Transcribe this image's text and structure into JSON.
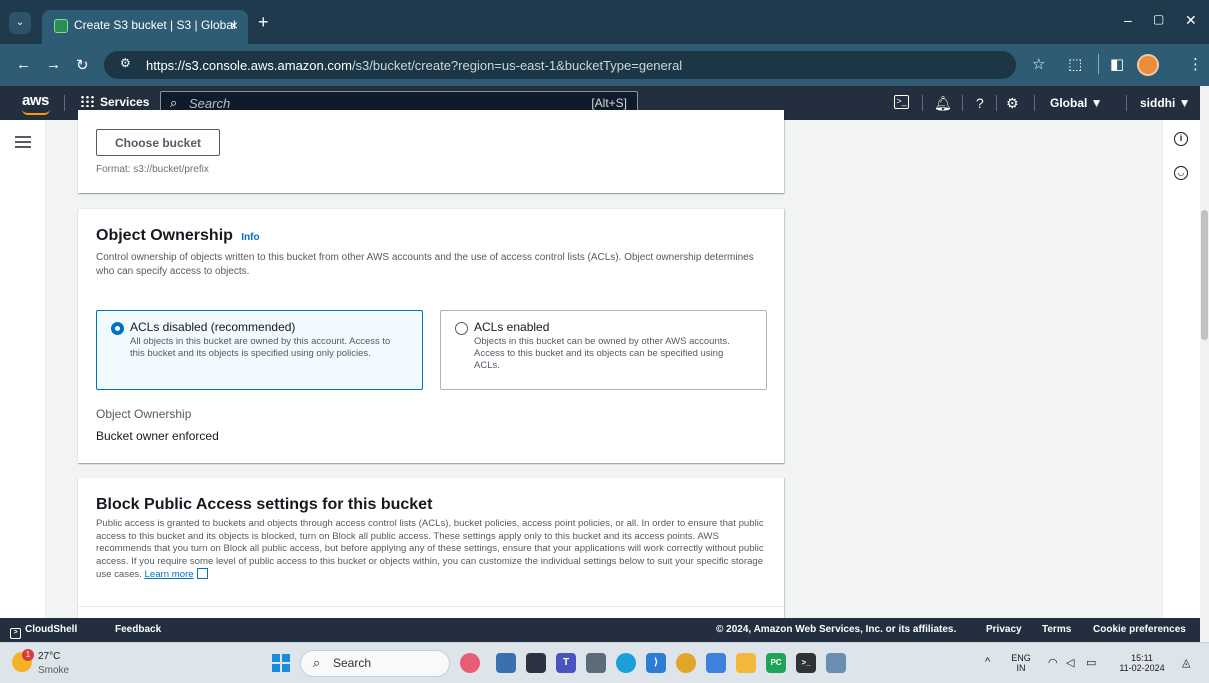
{
  "browser": {
    "tab_title": "Create S3 bucket | S3 | Global",
    "tab_close": "×",
    "new_tab": "+",
    "url_host": "https://s3.console.aws.amazon.com",
    "url_path": "/s3/bucket/create?region=us-east-1&bucketType=general",
    "win_minimize": "–",
    "win_restore": "▢",
    "win_close": "✕"
  },
  "aws_nav": {
    "logo": "aws",
    "services": "Services",
    "search_placeholder": "Search",
    "search_shortcut": "[Alt+S]",
    "region": "Global ▼",
    "user": "siddhi ▼"
  },
  "choose_bucket_panel": {
    "button": "Choose bucket",
    "format_hint": "Format: s3://bucket/prefix"
  },
  "object_ownership": {
    "title": "Object Ownership",
    "info": "Info",
    "description": "Control ownership of objects written to this bucket from other AWS accounts and the use of access control lists (ACLs). Object ownership determines who can specify access to objects.",
    "options": [
      {
        "label": "ACLs disabled (recommended)",
        "description": "All objects in this bucket are owned by this account. Access to this bucket and its objects is specified using only policies.",
        "selected": true
      },
      {
        "label": "ACLs enabled",
        "description": "Objects in this bucket can be owned by other AWS accounts. Access to this bucket and its objects can be specified using ACLs.",
        "selected": false
      }
    ],
    "field_label": "Object Ownership",
    "field_value": "Bucket owner enforced"
  },
  "block_public_access": {
    "title": "Block Public Access settings for this bucket",
    "description": "Public access is granted to buckets and objects through access control lists (ACLs), bucket policies, access point policies, or all. In order to ensure that public access to this bucket and its objects is blocked, turn on Block all public access. These settings apply only to this bucket and its access points. AWS recommends that you turn on Block all public access, but before applying any of these settings, ensure that your applications will work correctly without public access. If you require some level of public access to this bucket or objects within, you can customize the individual settings below to suit your specific storage use cases.",
    "learn_more": "Learn more"
  },
  "footer": {
    "cloudshell": "CloudShell",
    "feedback": "Feedback",
    "copyright": "© 2024, Amazon Web Services, Inc. or its affiliates.",
    "privacy": "Privacy",
    "terms": "Terms",
    "cookies": "Cookie preferences"
  },
  "taskbar": {
    "weather_badge": "1",
    "temperature": "27°C",
    "condition": "Smoke",
    "search": "Search",
    "lang_top": "ENG",
    "lang_bottom": "IN",
    "time": "15:11",
    "date": "11-02-2024"
  },
  "colors": {
    "aws_nav": "#232f3e",
    "accent_blue": "#0073bb",
    "browser_frame": "#2e5c74"
  }
}
